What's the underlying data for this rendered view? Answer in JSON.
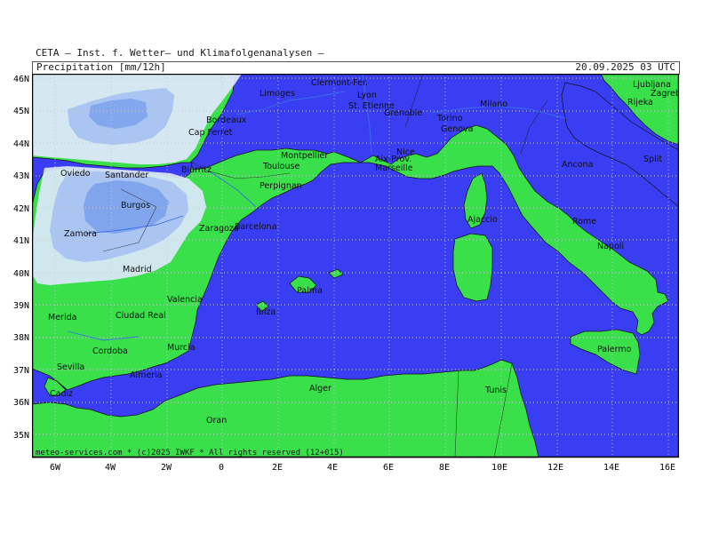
{
  "header": {
    "organization": "CETA — Inst. f. Wetter— und Klimafolgenanalysen —",
    "variable": "Precipitation [mm/12h]",
    "valid_time": "20.09.2025 03 UTC"
  },
  "footer": "meteo-services.com * (c)2025 IWKF * All rights reserved (12+015)",
  "axes": {
    "lon_ticks": [
      "6W",
      "4W",
      "2W",
      "0",
      "2E",
      "4E",
      "6E",
      "8E",
      "10E",
      "12E",
      "14E",
      "16E"
    ],
    "lat_ticks": [
      "46N",
      "45N",
      "44N",
      "43N",
      "42N",
      "41N",
      "40N",
      "39N",
      "38N",
      "37N",
      "36N",
      "35N"
    ]
  },
  "colors": {
    "sea": "#3a3ef2",
    "land": "#3ae04a",
    "precip_light": "#dde8fb",
    "precip_medium": "#a9c3f2",
    "precip_heavy": "#7ea3ec",
    "rivers": "#3a6ee8",
    "borders": "#1a1a1a"
  },
  "cities": [
    {
      "name": "Limoges"
    },
    {
      "name": "Clermont-Fer."
    },
    {
      "name": "Lyon"
    },
    {
      "name": "St. Etienne"
    },
    {
      "name": "Grenoble"
    },
    {
      "name": "Torino"
    },
    {
      "name": "Genova"
    },
    {
      "name": "Milano"
    },
    {
      "name": "Ljubljana"
    },
    {
      "name": "Zagreb"
    },
    {
      "name": "Rijeka"
    },
    {
      "name": "Split"
    },
    {
      "name": "Bordeaux"
    },
    {
      "name": "Cap Ferret"
    },
    {
      "name": "Montpellier"
    },
    {
      "name": "Toulouse"
    },
    {
      "name": "Nice"
    },
    {
      "name": "Aix-Prov."
    },
    {
      "name": "Marseille"
    },
    {
      "name": "Ancona"
    },
    {
      "name": "Oviedo"
    },
    {
      "name": "Santander"
    },
    {
      "name": "Biarritz"
    },
    {
      "name": "Perpignan"
    },
    {
      "name": "Burgos"
    },
    {
      "name": "Zaragoza"
    },
    {
      "name": "Barcelona"
    },
    {
      "name": "Ajaccio"
    },
    {
      "name": "Rome"
    },
    {
      "name": "Zamora"
    },
    {
      "name": "Napoli"
    },
    {
      "name": "Madrid"
    },
    {
      "name": "Valencia"
    },
    {
      "name": "Palma"
    },
    {
      "name": "Merida"
    },
    {
      "name": "Ciudad Real"
    },
    {
      "name": "Ibiza"
    },
    {
      "name": "Murcia"
    },
    {
      "name": "Cordoba"
    },
    {
      "name": "Palermo"
    },
    {
      "name": "Sevilla"
    },
    {
      "name": "Almeria"
    },
    {
      "name": "Alger"
    },
    {
      "name": "Tunis"
    },
    {
      "name": "Cadiz"
    },
    {
      "name": "Oran"
    }
  ]
}
